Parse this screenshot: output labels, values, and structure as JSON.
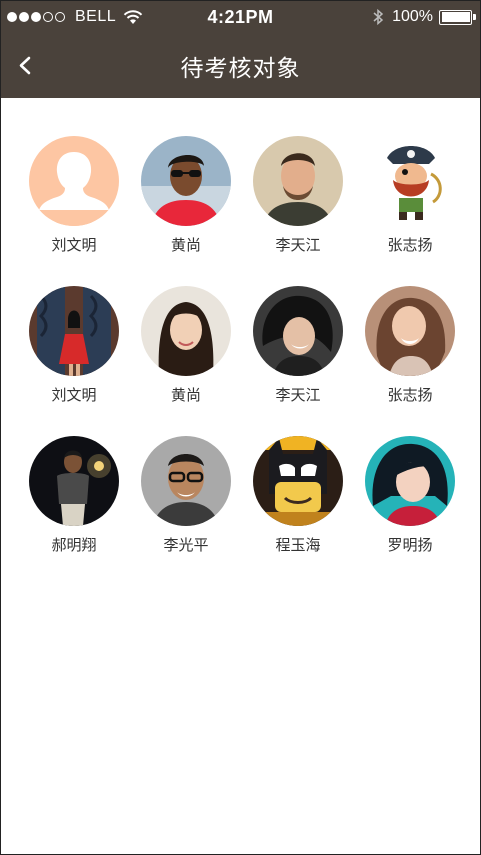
{
  "status_bar": {
    "carrier": "BELL",
    "time": "4:21PM",
    "battery": "100%",
    "signal_filled": 3,
    "signal_total": 5
  },
  "nav": {
    "title": "待考核对象",
    "back_icon": "chevron-left-icon"
  },
  "colors": {
    "nav_bg": "#4a423b",
    "text": "#333333"
  },
  "people": [
    {
      "name": "刘文明",
      "avatar": "default-silhouette"
    },
    {
      "name": "黄尚",
      "avatar": "photo"
    },
    {
      "name": "李天江",
      "avatar": "photo"
    },
    {
      "name": "张志扬",
      "avatar": "pirate-illustration"
    },
    {
      "name": "刘文明",
      "avatar": "photo"
    },
    {
      "name": "黄尚",
      "avatar": "photo"
    },
    {
      "name": "李天江",
      "avatar": "photo"
    },
    {
      "name": "张志扬",
      "avatar": "photo"
    },
    {
      "name": "郝明翔",
      "avatar": "photo"
    },
    {
      "name": "李光平",
      "avatar": "photo"
    },
    {
      "name": "程玉海",
      "avatar": "lego-batman-photo"
    },
    {
      "name": "罗明扬",
      "avatar": "photo"
    }
  ]
}
